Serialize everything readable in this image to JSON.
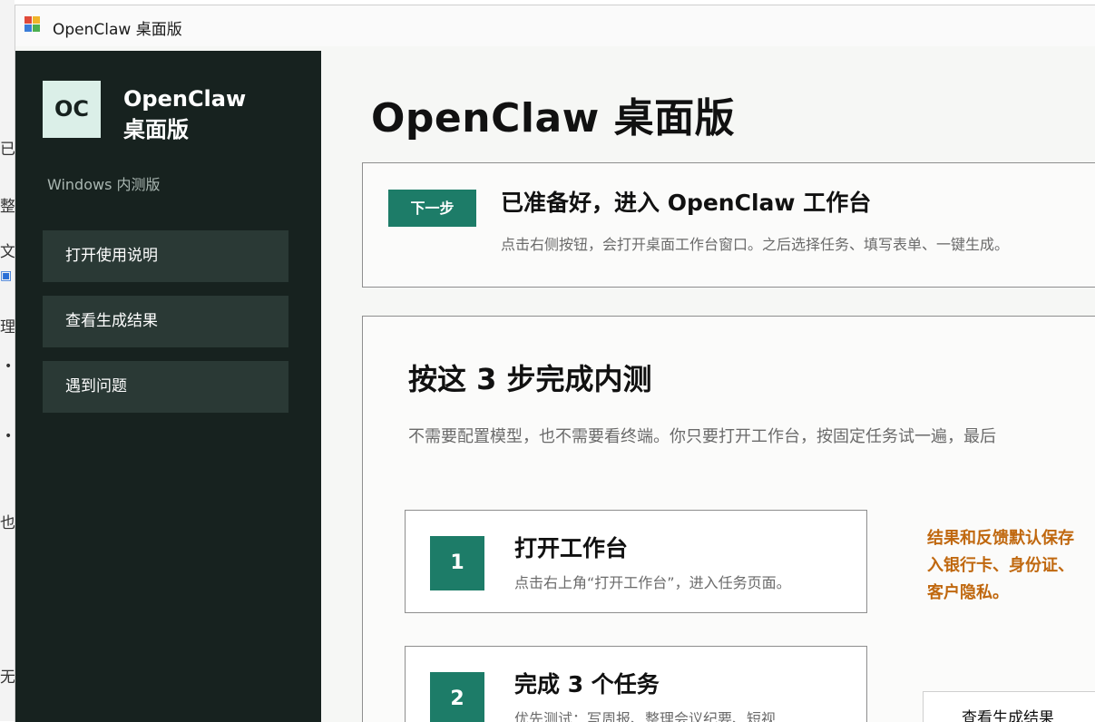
{
  "window": {
    "title": "OpenClaw 桌面版"
  },
  "background_fragments": [
    "已",
    "整",
    "文",
    "理",
    "也",
    "无"
  ],
  "sidebar": {
    "logo_text": "OC",
    "brand_line1": "OpenClaw",
    "brand_line2": "桌面版",
    "edition": "Windows 内测版",
    "items": [
      {
        "label": "打开使用说明"
      },
      {
        "label": "查看生成结果"
      },
      {
        "label": "遇到问题"
      }
    ]
  },
  "main": {
    "title": "OpenClaw 桌面版",
    "next_card": {
      "badge": "下一步",
      "heading": "已准备好，进入 OpenClaw 工作台",
      "description": "点击右侧按钮，会打开桌面工作台窗口。之后选择任务、填写表单、一键生成。"
    },
    "steps_card": {
      "heading": "按这 3 步完成内测",
      "description": "不需要配置模型，也不需要看终端。你只要打开工作台，按固定任务试一遍，最后",
      "steps": [
        {
          "number": "1",
          "title": "打开工作台",
          "description": "点击右上角“打开工作台”，进入任务页面。"
        },
        {
          "number": "2",
          "title": "完成 3 个任务",
          "description": "优先测试：写周报、整理会议纪要、短视..."
        }
      ],
      "notice_lines": [
        "结果和反馈默认保存",
        "入银行卡、身份证、",
        "客户隐私。"
      ],
      "result_button": "查看生成结果"
    }
  },
  "colors": {
    "sidebar_bg": "#17221f",
    "nav_item_bg": "#2a3935",
    "accent": "#1d7c68",
    "notice": "#c0680f"
  }
}
